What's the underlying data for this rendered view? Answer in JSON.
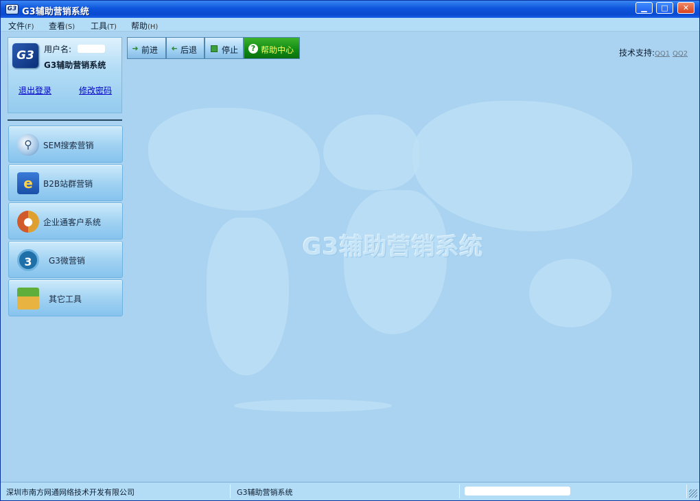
{
  "window": {
    "title": "G3辅助营销系统",
    "icon_text": "G3",
    "controls": {
      "minimize": "▁",
      "maximize": "□",
      "close": "✕"
    }
  },
  "menu": [
    {
      "label": "文件",
      "accel": "(F)"
    },
    {
      "label": "查看",
      "accel": "(S)"
    },
    {
      "label": "工具",
      "accel": "(T)"
    },
    {
      "label": "帮助",
      "accel": "(H)"
    }
  ],
  "user_panel": {
    "logo_text": "G3",
    "username_label": "用户名:",
    "app_name": "G3辅助营销系统",
    "logout_link": "退出登录",
    "change_password_link": "修改密码"
  },
  "nav": [
    {
      "label": "SEM搜索营销",
      "icon": "search-magnifier-icon"
    },
    {
      "label": "B2B站群营销",
      "icon": "browser-e-icon"
    },
    {
      "label": "企业通客户系统",
      "icon": "users-icon"
    },
    {
      "label": "G3微营销",
      "icon": "g3-play-icon"
    },
    {
      "label": "其它工具",
      "icon": "toolbox-icon"
    }
  ],
  "toolbar": {
    "forward": "前进",
    "back": "后退",
    "stop": "停止",
    "help_center": "帮助中心"
  },
  "support": {
    "label": "技术支持:",
    "qq1": "QQ1",
    "qq2": "QQ2"
  },
  "watermark": "G3辅助营销系统",
  "statusbar": {
    "company": "深圳市南方网通网络技术开发有限公司",
    "app": "G3辅助营销系统"
  },
  "colors": {
    "titlebar": "#0d55dc",
    "background": "#a9d3f0",
    "help_button": "#0f8a12",
    "link": "#0000c8"
  }
}
